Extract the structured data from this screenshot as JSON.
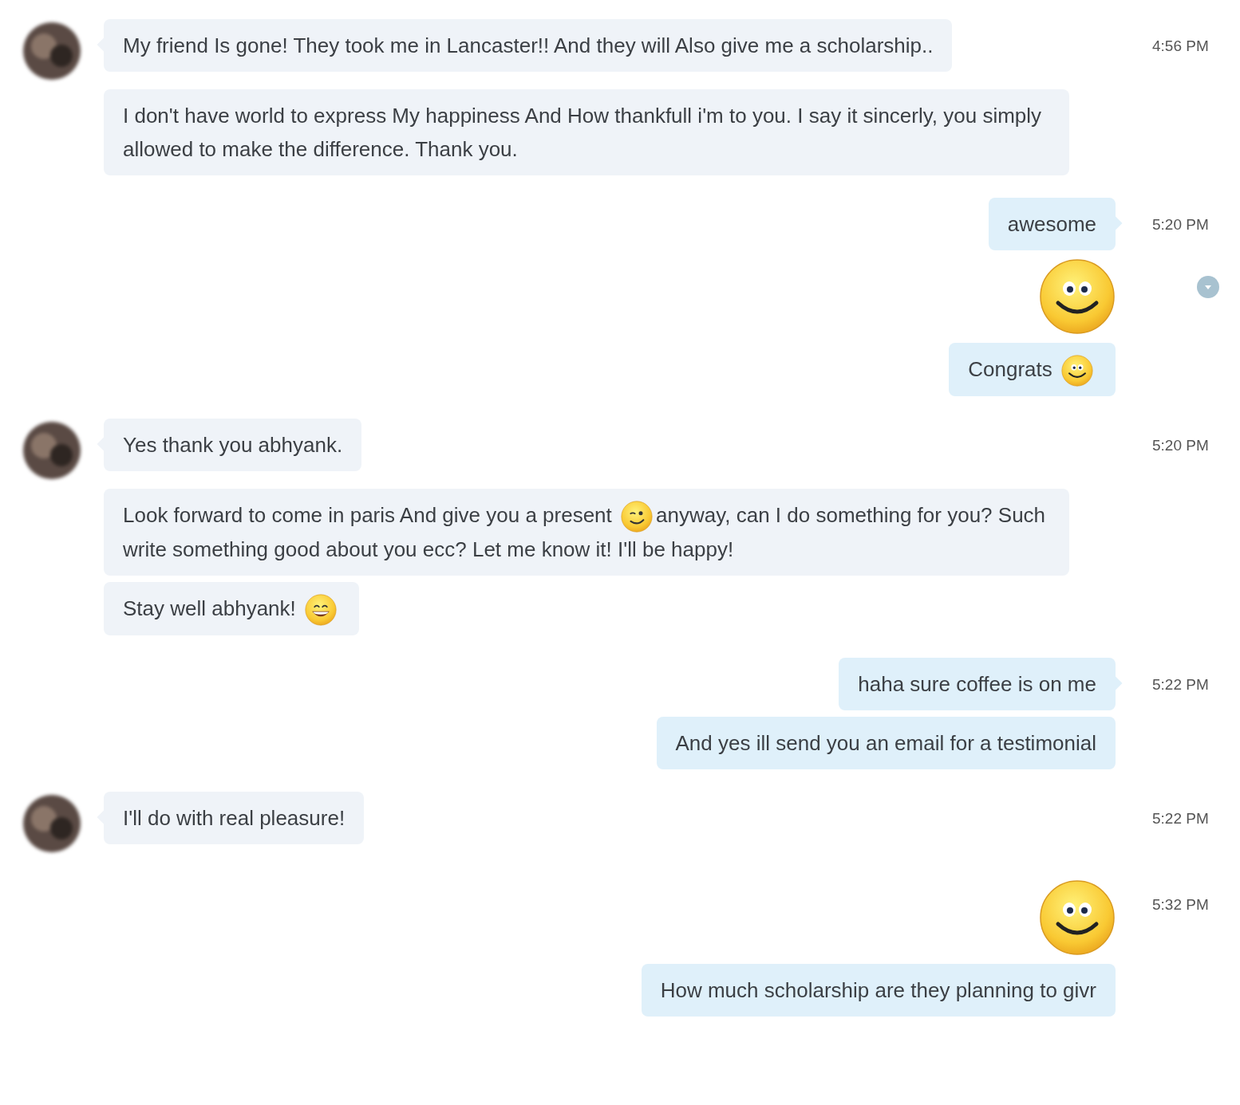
{
  "groups": [
    {
      "kind": "incoming",
      "messages": [
        {
          "kind": "text",
          "time": "4:56 PM",
          "segments": [
            {
              "kind": "text",
              "text": "My friend Is gone! They took me in Lancaster!! And they will Also give me a scholarship.."
            }
          ]
        },
        {
          "kind": "text",
          "segments": [
            {
              "kind": "text",
              "text": "I don't have world to express My happiness And How thankfull i'm to you. I say it sincerly, you simply allowed to make the difference. Thank you."
            }
          ]
        }
      ]
    },
    {
      "kind": "outgoing",
      "messages": [
        {
          "kind": "text",
          "time": "5:20 PM",
          "segments": [
            {
              "kind": "text",
              "text": "awesome"
            }
          ]
        },
        {
          "kind": "smile_emoticon",
          "menu_button": true
        },
        {
          "kind": "text",
          "segments": [
            {
              "kind": "text",
              "text": "Congrats"
            },
            {
              "kind": "smile_emoji"
            }
          ]
        }
      ]
    },
    {
      "kind": "incoming",
      "messages": [
        {
          "kind": "text",
          "time": "5:20 PM",
          "segments": [
            {
              "kind": "text",
              "text": "Yes thank you abhyank."
            }
          ]
        },
        {
          "kind": "text",
          "segments": [
            {
              "kind": "text",
              "text": "Look forward to come in paris And give you a present"
            },
            {
              "kind": "wink_emoji"
            },
            {
              "kind": "text",
              "text": "anyway, can I do something for you? Such write something good about you ecc? Let me know it! I'll be happy!"
            }
          ]
        },
        {
          "kind": "text",
          "segments": [
            {
              "kind": "text",
              "text": "Stay well abhyank!"
            },
            {
              "kind": "grin_emoji"
            }
          ]
        }
      ]
    },
    {
      "kind": "outgoing",
      "messages": [
        {
          "kind": "text",
          "time": "5:22 PM",
          "segments": [
            {
              "kind": "text",
              "text": "haha sure coffee is on me"
            }
          ]
        },
        {
          "kind": "text",
          "segments": [
            {
              "kind": "text",
              "text": "And yes ill send you an email for a testimonial"
            }
          ]
        }
      ]
    },
    {
      "kind": "incoming",
      "messages": [
        {
          "kind": "text",
          "time": "5:22 PM",
          "segments": [
            {
              "kind": "text",
              "text": "I'll do with real pleasure!"
            }
          ]
        }
      ]
    },
    {
      "kind": "outgoing",
      "messages": [
        {
          "kind": "smile_emoticon",
          "time": "5:32 PM"
        },
        {
          "kind": "text",
          "segments": [
            {
              "kind": "text",
              "text": "How much scholarship are they planning to givr"
            }
          ]
        }
      ]
    }
  ]
}
